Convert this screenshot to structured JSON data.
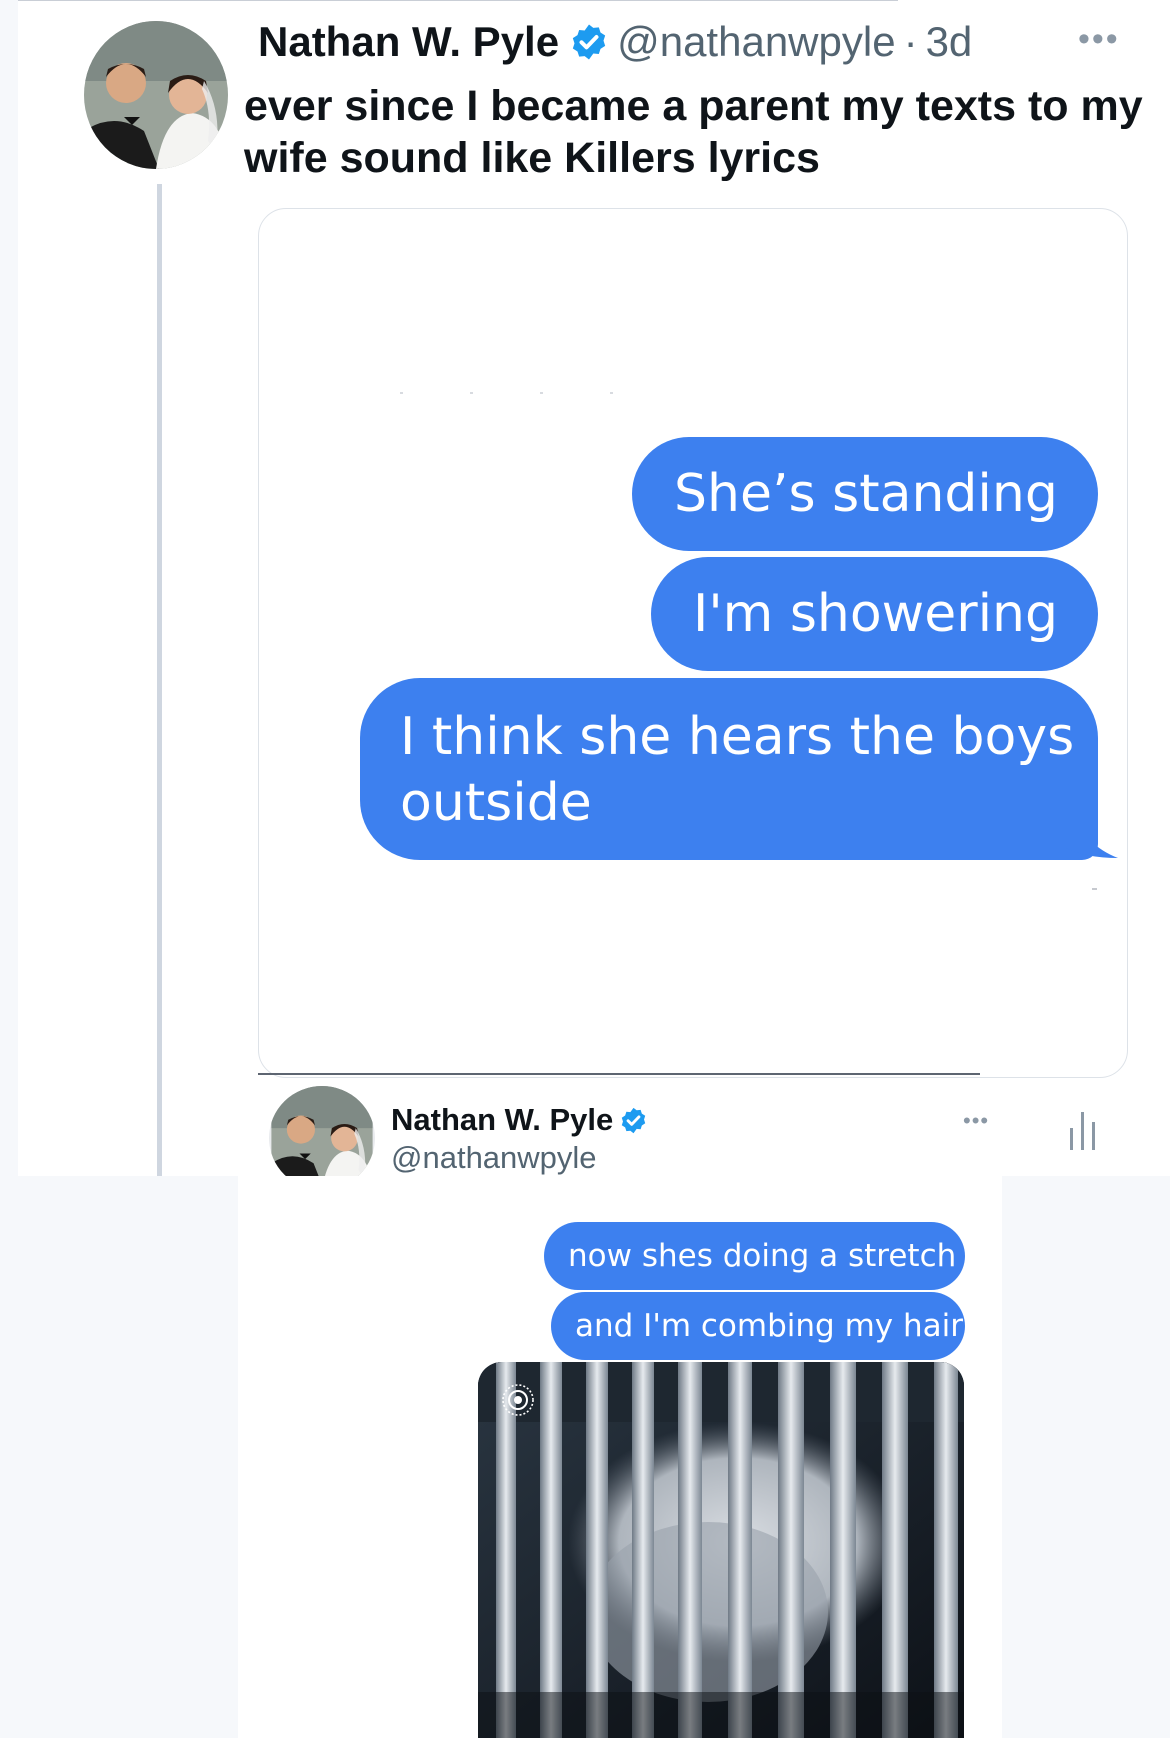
{
  "tweet": {
    "author_name": "Nathan W. Pyle",
    "handle": "@nathanwpyle",
    "separator": "·",
    "time": "3d",
    "more_icon": "more-dots-icon",
    "text": "ever since I became a parent my texts to my wife sound like Killers lyrics"
  },
  "screenshot_messages": [
    "She’s standing",
    "I'm showering",
    "I think she hears the boys outside"
  ],
  "quoted": {
    "author_name": "Nathan W. Pyle",
    "handle": "@nathanwpyle",
    "messages": [
      "now shes doing a stretch",
      "and I'm combing my hair"
    ],
    "attachment": "baby-monitor-photo",
    "icons": [
      "verified-badge-icon",
      "more-dots-icon",
      "audio-bars-icon",
      "live-photo-icon"
    ]
  },
  "colors": {
    "bubble_blue": "#3d80ef",
    "verified_blue": "#1d9bf0",
    "name_text": "#0f1419",
    "handle_text": "#536471"
  }
}
